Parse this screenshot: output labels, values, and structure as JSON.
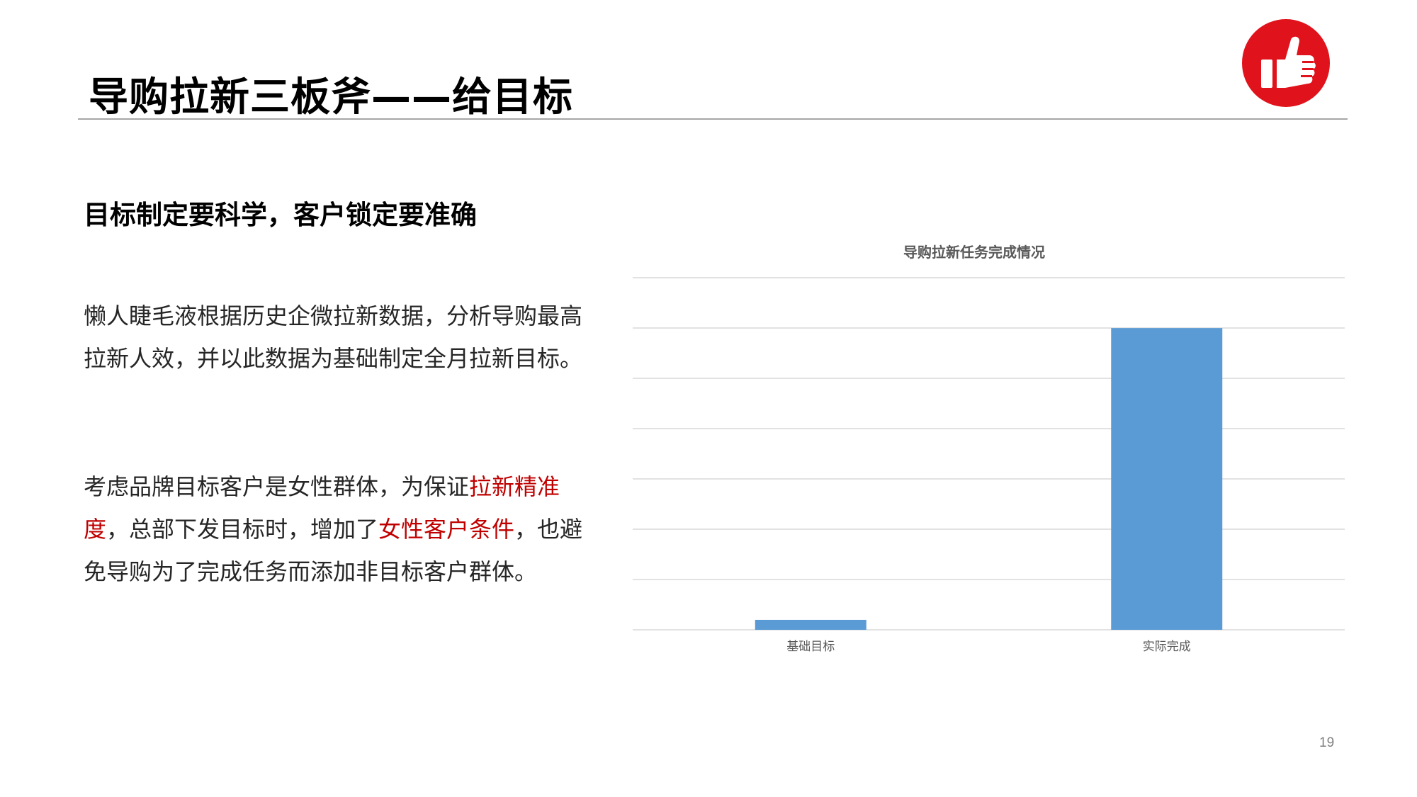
{
  "slide": {
    "title": "导购拉新三板斧——给目标",
    "subheading": "目标制定要科学，客户锁定要准确",
    "paragraph1": "懒人睫毛液根据历史企微拉新数据，分析导购最高拉新人效，并以此数据为基础制定全月拉新目标。",
    "paragraph2": {
      "part1": "考虑品牌目标客户是女性群体，为保证",
      "highlight1": "拉新精准度",
      "part2": "，总部下发目标时，增加了",
      "highlight2": "女性客户条件",
      "part3": "，也避免导购为了完成任务而添加非目标客户群体。"
    },
    "page_number": "19",
    "logo_icon": "thumbs-up-icon",
    "colors": {
      "accent_red": "#c00000",
      "logo_red": "#e0121b",
      "bar_blue": "#5b9bd5",
      "gridline": "#d9d9d9"
    }
  },
  "chart_data": {
    "type": "bar",
    "title": "导购拉新任务完成情况",
    "categories": [
      "基础目标",
      "实际完成"
    ],
    "values": [
      0.033,
      1.0
    ],
    "ylim": [
      0,
      1.167
    ],
    "grid": true,
    "gridlines": 8,
    "xlabel": "",
    "ylabel": ""
  }
}
